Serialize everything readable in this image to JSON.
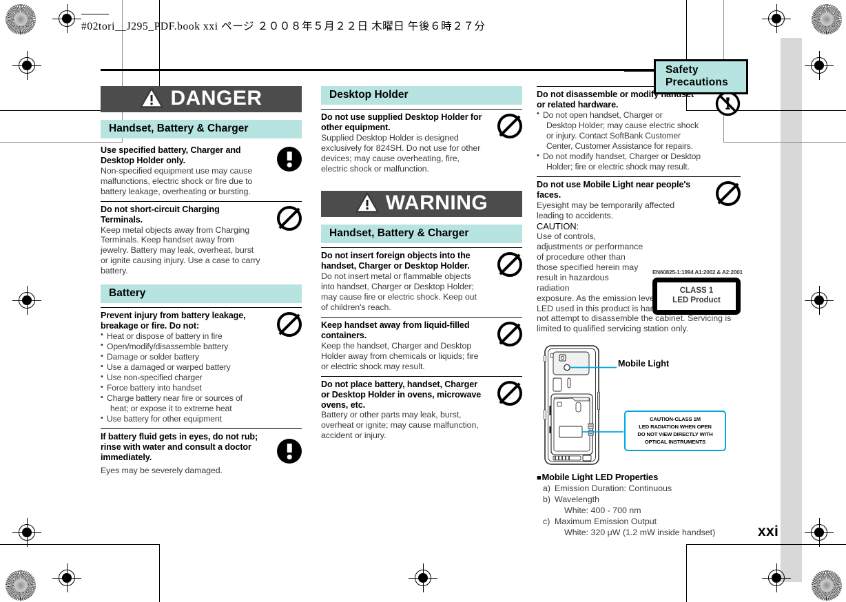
{
  "print_header": {
    "text": "#02tori__J295_PDF.book   xxi ページ   ２００８年５月２２日   木曜日   午後６時２７分"
  },
  "section_tab": {
    "label": "Safety Precautions"
  },
  "folio": {
    "page_number": "xxi"
  },
  "colors": {
    "accent_cyan": "#b7e4e0",
    "banner_gray": "#4c4c4c",
    "callout_blue": "#00a8e0",
    "reg_band_gray": "#d8d8d8"
  },
  "columns": [
    {
      "id": "column-1",
      "blocks": [
        {
          "kind": "banner",
          "label": "DANGER",
          "icon": "warning-triangle-icon"
        },
        {
          "kind": "subhead",
          "label": "Handset, Battery & Charger"
        },
        {
          "kind": "entry",
          "rule": false,
          "title": "Use specified battery, Charger and Desktop Holder only.",
          "text": "Non-specified equipment use may cause malfunctions, electric shock or fire due to battery leakage, overheating or bursting.",
          "icon": "mandatory-alert-icon"
        },
        {
          "kind": "entry",
          "rule": true,
          "title": "Do not short-circuit Charging Terminals.",
          "text": "Keep metal objects away from Charging Terminals. Keep handset away from jewelry. Battery may leak, overheat, burst or ignite causing injury. Use a case to carry battery.",
          "icon": "prohibition-icon"
        },
        {
          "kind": "subhead",
          "label": "Battery"
        },
        {
          "kind": "entry",
          "rule": true,
          "title": "Prevent injury from battery leakage, breakage or fire. Do not:",
          "bullets": [
            {
              "text": "Heat or dispose of battery in fire",
              "continuation": false
            },
            {
              "text": "Open/modify/disassemble battery",
              "continuation": false
            },
            {
              "text": "Damage or solder battery",
              "continuation": false
            },
            {
              "text": "Use a damaged or warped battery",
              "continuation": false
            },
            {
              "text": "Use non-specified charger",
              "continuation": false
            },
            {
              "text": "Force battery into handset",
              "continuation": false
            },
            {
              "text": "Charge battery near fire or sources of",
              "continuation": false
            },
            {
              "text": "heat; or expose it to extreme heat",
              "continuation": true
            },
            {
              "text": "Use battery for other equipment",
              "continuation": false
            }
          ],
          "icon": "prohibition-icon"
        },
        {
          "kind": "entry",
          "rule": true,
          "title": "If battery fluid gets in eyes, do not rub; rinse with water and consult a doctor immediately.",
          "text": "Eyes may be severely damaged.",
          "icon": "mandatory-alert-icon"
        }
      ]
    },
    {
      "id": "column-2",
      "blocks": [
        {
          "kind": "subhead",
          "label": "Desktop Holder"
        },
        {
          "kind": "entry",
          "rule": true,
          "title": "Do not use supplied Desktop Holder for other equipment.",
          "text": "Supplied Desktop Holder is designed exclusively for 824SH. Do not use for other devices; may cause overheating, fire, electric shock or malfunction.",
          "icon": "prohibition-icon"
        },
        {
          "kind": "banner",
          "label": "WARNING",
          "icon": "warning-triangle-icon"
        },
        {
          "kind": "subhead",
          "label": "Handset, Battery & Charger"
        },
        {
          "kind": "entry",
          "rule": true,
          "title": "Do not insert foreign objects into the handset, Charger or Desktop Holder.",
          "text": "Do not insert metal or flammable objects into handset, Charger or Desktop Holder; may cause fire or electric shock. Keep out of children's reach.",
          "icon": "prohibition-icon"
        },
        {
          "kind": "entry",
          "rule": true,
          "title": "Keep handset away from liquid-filled containers.",
          "text": "Keep the handset, Charger and Desktop Holder away from chemicals or liquids; fire or electric shock may result.",
          "icon": "prohibition-icon"
        },
        {
          "kind": "entry",
          "rule": true,
          "title": "Do not place battery, handset, Charger or Desktop Holder in ovens, microwave ovens, etc.",
          "text": "Battery or other parts may leak, burst, overheat or ignite; may cause malfunction, accident or injury.",
          "icon": "prohibition-icon"
        }
      ]
    },
    {
      "id": "column-3",
      "blocks": [
        {
          "kind": "entry",
          "rule": true,
          "title": "Do not disassemble or modify handset or related hardware.",
          "bullets": [
            {
              "text": "Do not open handset, Charger or",
              "continuation": false
            },
            {
              "text": "Desktop Holder; may cause electric shock",
              "continuation": true
            },
            {
              "text": "or injury. Contact SoftBank Customer",
              "continuation": true
            },
            {
              "text": "Center, Customer Assistance for repairs.",
              "continuation": true
            },
            {
              "text": "Do not modify handset, Charger or Desktop",
              "continuation": false
            },
            {
              "text": "Holder; fire or electric shock may result.",
              "continuation": true
            }
          ],
          "icon": "no-disassembly-icon"
        },
        {
          "kind": "caution-entry",
          "rule": true,
          "title": "Do not use Mobile Light near people's faces.",
          "text_top": "Eyesight may be temporarily affected leading to accidents.",
          "caution_heading": "CAUTION:",
          "caution_narrow": "Use of controls, adjustments or performance of procedure other than those specified herein may result in hazardous radiation",
          "caution_wide": "exposure. As the emission level from Mobile Light LED used in this product is harmful to the eyes, do not attempt to disassemble the cabinet. Servicing is limited to qualified servicing station only.",
          "icon": "prohibition-icon",
          "led_label": {
            "standard_code": "EN60825-1:1994  A1:2002 & A2:2001",
            "line1": "CLASS 1",
            "line2": "LED Product"
          }
        }
      ]
    }
  ],
  "diagram": {
    "name": "handset-back-view",
    "callout_label": "Mobile Light",
    "caution_label_lines": [
      "CAUTION-CLASS 1M",
      "LED RADIATION WHEN OPEN",
      "DO NOT VIEW DIRECTLY WITH",
      "OPTICAL INSTRUMENTS"
    ]
  },
  "led_properties": {
    "title": "Mobile Light LED Properties",
    "items": [
      {
        "marker": "a)",
        "label": "Emission Duration: Continuous",
        "sub": ""
      },
      {
        "marker": "b)",
        "label": "Wavelength",
        "sub": "White: 400 - 700 nm"
      },
      {
        "marker": "c)",
        "label": "Maximum Emission Output",
        "sub": "White: 320 μW (1.2 mW inside handset)"
      }
    ]
  }
}
